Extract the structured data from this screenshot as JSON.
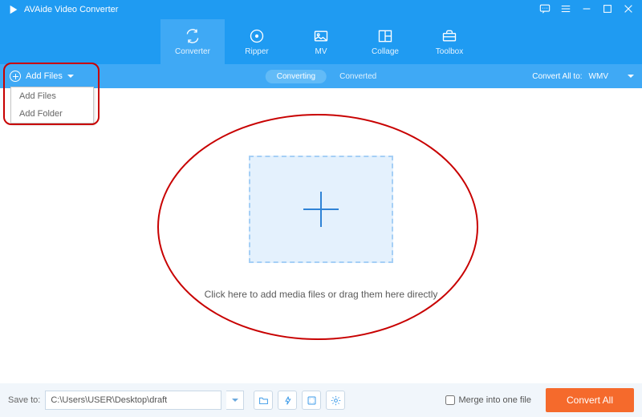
{
  "title": "AVAide Video Converter",
  "tabs": {
    "converter": "Converter",
    "ripper": "Ripper",
    "mv": "MV",
    "collage": "Collage",
    "toolbox": "Toolbox"
  },
  "addFiles": {
    "button": "Add Files",
    "menu": {
      "addFiles": "Add Files",
      "addFolder": "Add Folder"
    }
  },
  "subtabs": {
    "converting": "Converting",
    "converted": "Converted"
  },
  "convertAllTo": {
    "label": "Convert All to:",
    "value": "WMV"
  },
  "dropHint": "Click here to add media files or drag them here directly",
  "footer": {
    "saveToLabel": "Save to:",
    "path": "C:\\Users\\USER\\Desktop\\draft",
    "mergeLabel": "Merge into one file",
    "convertAll": "Convert All"
  }
}
